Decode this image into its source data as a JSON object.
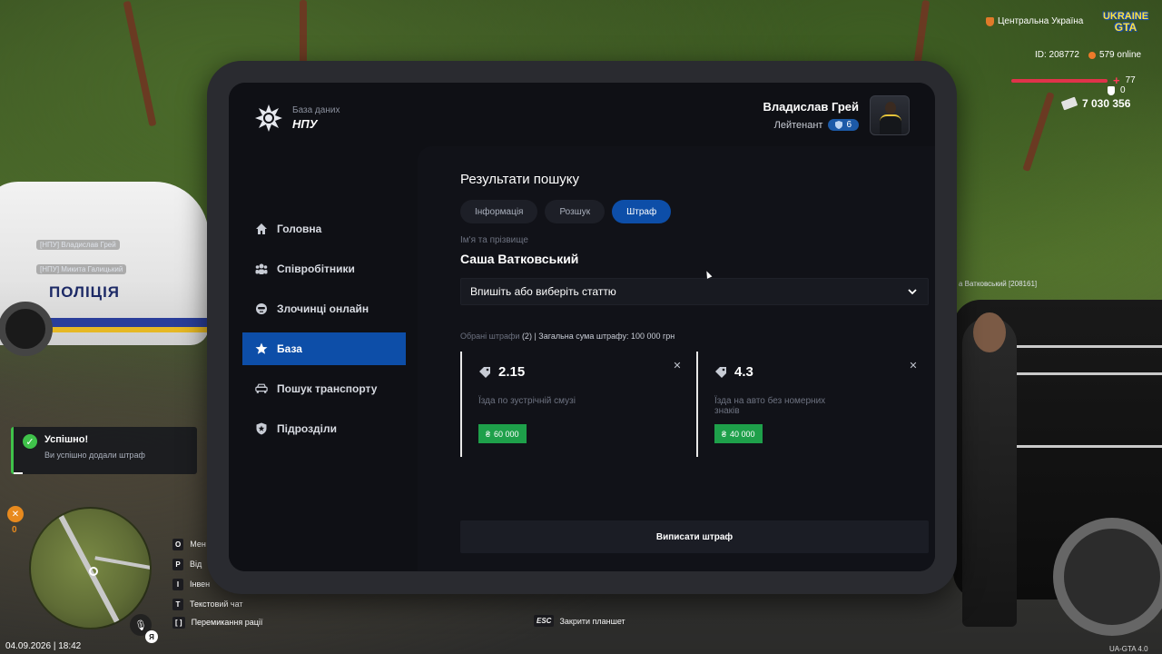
{
  "scene": {
    "car_left_label": "ПОЛІЦІЯ",
    "tag_1": "[НПУ] Владислав Грей",
    "tag_2": "[НПУ] Микита Галицький",
    "tag_right": "а Ватковський [208161]"
  },
  "hud": {
    "region": "Центральна Україна",
    "logo_line1": "UKRAINE",
    "logo_line2": "GTA",
    "id": "ID: 208772",
    "online": "579 online",
    "health": "77",
    "armor": "0",
    "money": "7 030 356",
    "colors": {
      "health": "#e0334a",
      "accent": "#0d4ea8",
      "success": "#1ea04a"
    }
  },
  "notification": {
    "title": "Успішно!",
    "text": "Ви успішно додали штраф"
  },
  "status": {
    "hunger": "0",
    "datetime": "04.09.2026 | 18:42",
    "lang": "Я",
    "version": "UA-GTA 4.0"
  },
  "hints": [
    {
      "key": "O",
      "label": "Мен"
    },
    {
      "key": "P",
      "label": "Від"
    },
    {
      "key": "I",
      "label": "Інвен"
    },
    {
      "key": "T",
      "label": "Текстовий чат"
    },
    {
      "key": "[   ]",
      "label": "Перемикання рації"
    }
  ],
  "esc": {
    "key": "ESC",
    "label": "Закрити планшет"
  },
  "tablet": {
    "brand": {
      "small": "База даних",
      "big": "НПУ"
    },
    "user": {
      "name": "Владислав Грей",
      "rank": "Лейтенант",
      "level": "6"
    },
    "nav": [
      {
        "label": "Головна",
        "icon": "home-icon"
      },
      {
        "label": "Співробітники",
        "icon": "users-icon"
      },
      {
        "label": "Злочинці онлайн",
        "icon": "mask-icon"
      },
      {
        "label": "База",
        "icon": "star-icon",
        "active": true
      },
      {
        "label": "Пошук транспорту",
        "icon": "car-icon"
      },
      {
        "label": "Підрозділи",
        "icon": "shield-icon"
      }
    ],
    "main": {
      "title": "Результати пошуку",
      "tabs": [
        {
          "label": "Інформація"
        },
        {
          "label": "Розшук"
        },
        {
          "label": "Штраф",
          "active": true
        }
      ],
      "name_label": "Ім'я та прізвище",
      "name_value": "Саша Ватковський",
      "article_select": "Впишіть або виберіть статтю",
      "summary_prefix": "Обрані штрафи",
      "summary_count": "(2)",
      "summary_total": "| Загальна сума штрафу: 100 000 грн",
      "fines": [
        {
          "code": "2.15",
          "desc": "Їзда по зустрічній смузі",
          "amount": "60 000"
        },
        {
          "code": "4.3",
          "desc": "Їзда на авто без номерних знаків",
          "amount": "40 000"
        }
      ],
      "submit": "Виписати штраф"
    }
  }
}
